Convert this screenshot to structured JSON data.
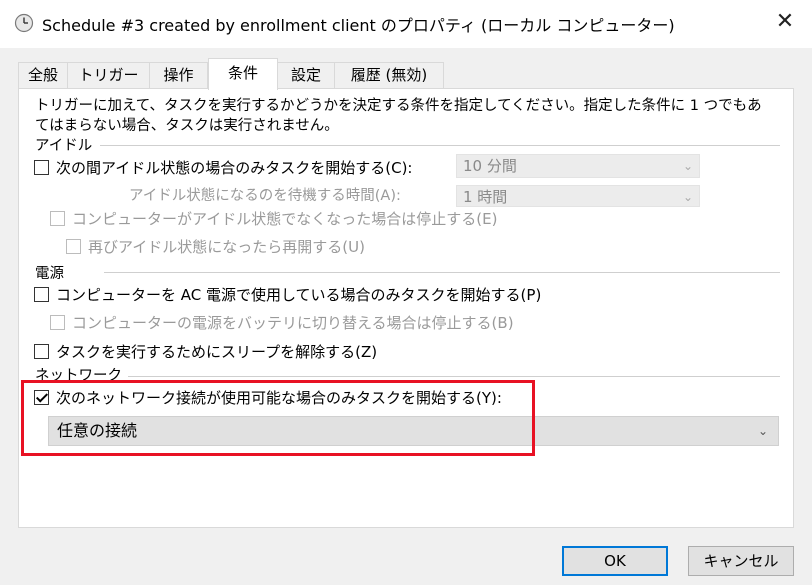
{
  "window": {
    "title": "Schedule #3 created by enrollment client のプロパティ (ローカル コンピューター)",
    "close_glyph": "✕",
    "icon": "clock-icon"
  },
  "tabs": [
    {
      "label": "全般"
    },
    {
      "label": "トリガー"
    },
    {
      "label": "操作"
    },
    {
      "label": "条件",
      "active": true
    },
    {
      "label": "設定"
    },
    {
      "label": "履歴 (無効)"
    }
  ],
  "description": "トリガーに加えて、タスクを実行するかどうかを決定する条件を指定してください。指定した条件に 1 つでもあてはまらない場合、タスクは実行されません。",
  "idle": {
    "group_label": "アイドル",
    "start_only_idle": {
      "label": "次の間アイドル状態の場合のみタスクを開始する(C):",
      "checked": false
    },
    "idle_duration": {
      "value": "10 分間"
    },
    "wait_label": "アイドル状態になるのを待機する時間(A):",
    "wait_duration": {
      "value": "1 時間"
    },
    "stop_on_idle_end": {
      "label": "コンピューターがアイドル状態でなくなった場合は停止する(E)",
      "checked": false,
      "enabled": false
    },
    "restart_on_idle": {
      "label": "再びアイドル状態になったら再開する(U)",
      "checked": false,
      "enabled": false
    }
  },
  "power": {
    "group_label": "電源",
    "ac_only": {
      "label": "コンピューターを AC 電源で使用している場合のみタスクを開始する(P)",
      "checked": false
    },
    "stop_on_battery": {
      "label": "コンピューターの電源をバッテリに切り替える場合は停止する(B)",
      "checked": false,
      "enabled": false
    },
    "wake": {
      "label": "タスクを実行するためにスリープを解除する(Z)",
      "checked": false
    }
  },
  "network": {
    "group_label": "ネットワーク",
    "only_if_network": {
      "label": "次のネットワーク接続が使用可能な場合のみタスクを開始する(Y):",
      "checked": true
    },
    "connection": {
      "value": "任意の接続"
    }
  },
  "buttons": {
    "ok": "OK",
    "cancel": "キャンセル"
  },
  "chevron_glyph": "⌄",
  "colors": {
    "highlight": "#e81123",
    "default_button_border": "#0078d7"
  }
}
